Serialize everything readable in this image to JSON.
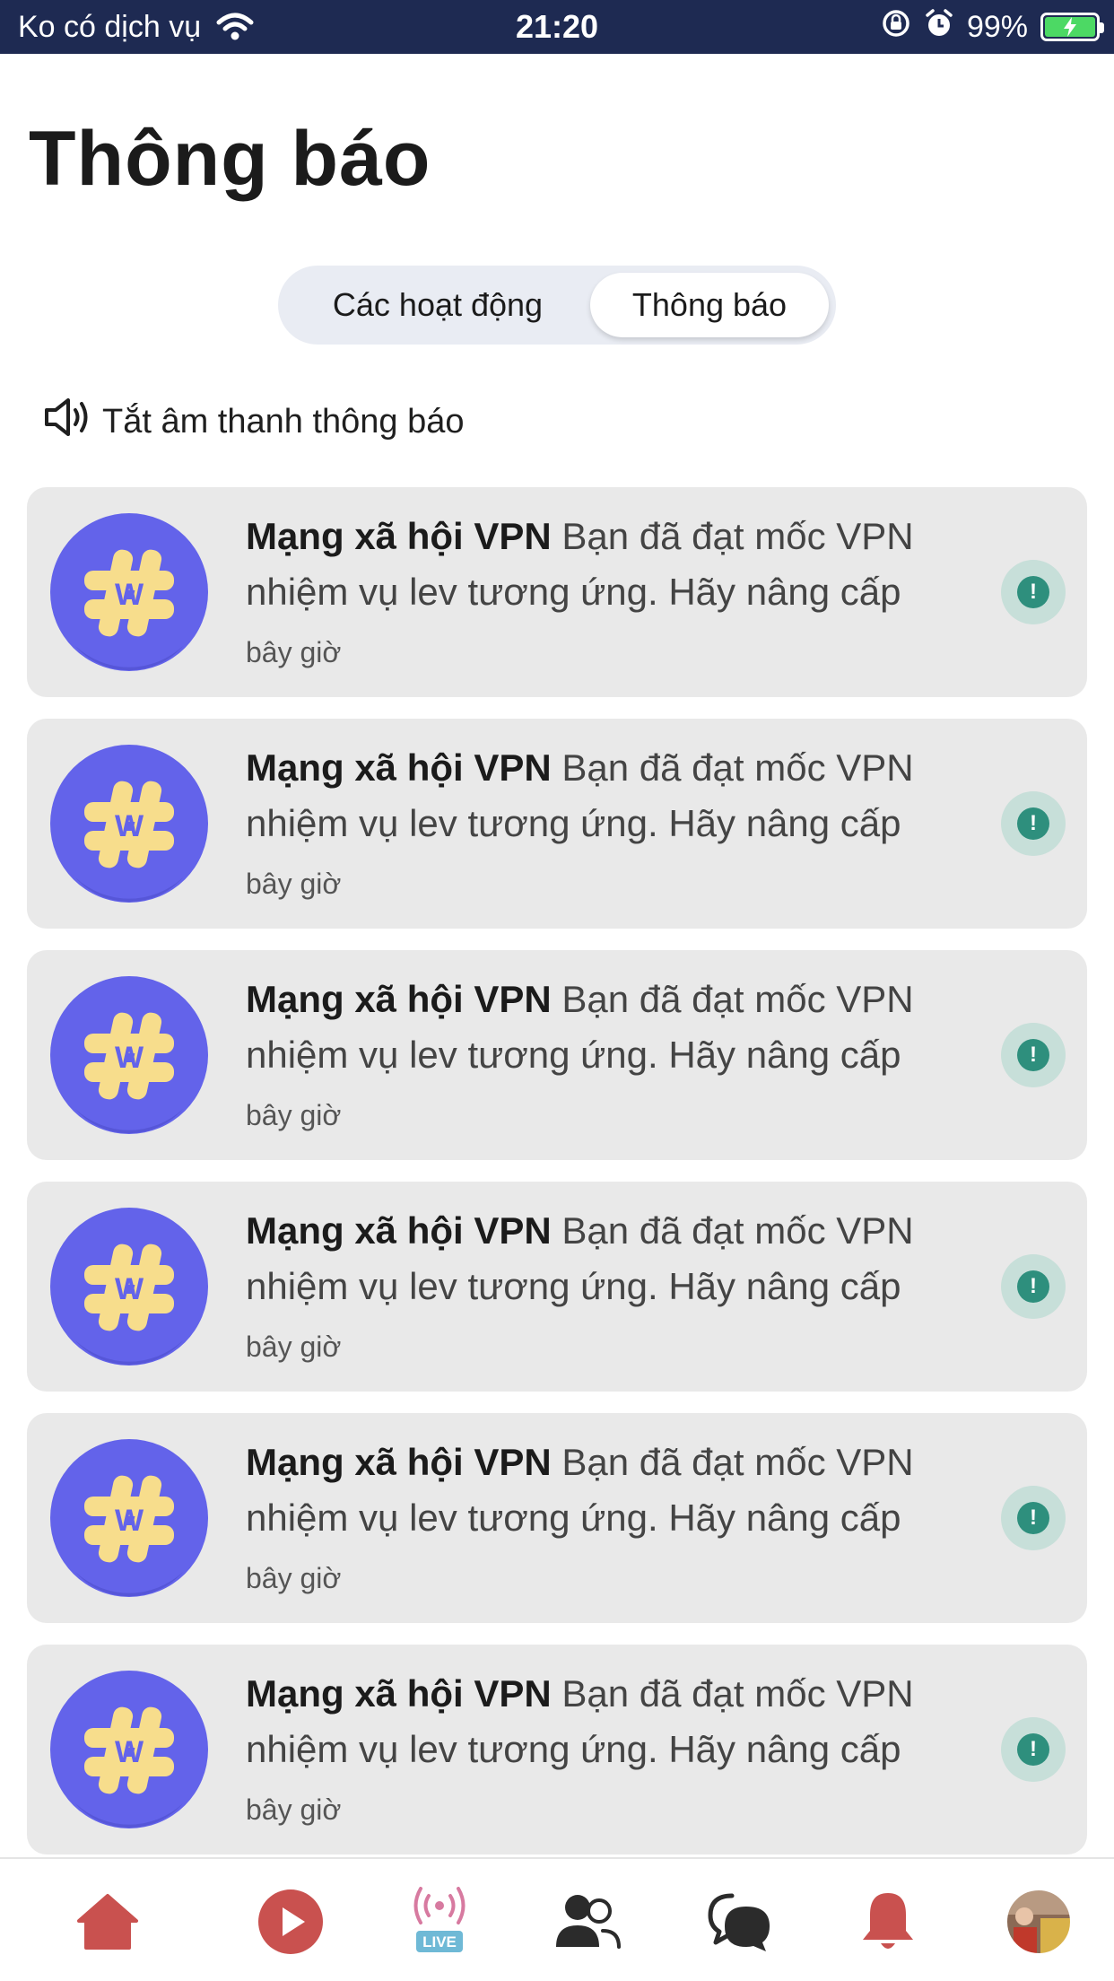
{
  "status_bar": {
    "carrier": "Ko có dịch vụ",
    "time": "21:20",
    "battery": "99%"
  },
  "header": {
    "title": "Thông báo"
  },
  "tabs": [
    {
      "label": "Các hoạt động",
      "active": false
    },
    {
      "label": "Thông báo",
      "active": true
    }
  ],
  "mute": {
    "label": "Tắt âm thanh thông báo"
  },
  "notifications": [
    {
      "sender": "Mạng xã hội VPN",
      "line1_rest": "Bạn đã đạt mốc VPN",
      "line2": "nhiệm vụ lev tương ứng. Hãy nâng cấp",
      "time": "bây giờ"
    },
    {
      "sender": "Mạng xã hội VPN",
      "line1_rest": "Bạn đã đạt mốc VPN",
      "line2": "nhiệm vụ lev tương ứng. Hãy nâng cấp",
      "time": "bây giờ"
    },
    {
      "sender": "Mạng xã hội VPN",
      "line1_rest": "Bạn đã đạt mốc VPN",
      "line2": "nhiệm vụ lev tương ứng. Hãy nâng cấp",
      "time": "bây giờ"
    },
    {
      "sender": "Mạng xã hội VPN",
      "line1_rest": "Bạn đã đạt mốc VPN",
      "line2": "nhiệm vụ lev tương ứng. Hãy nâng cấp",
      "time": "bây giờ"
    },
    {
      "sender": "Mạng xã hội VPN",
      "line1_rest": "Bạn đã đạt mốc VPN",
      "line2": "nhiệm vụ lev tương ứng. Hãy nâng cấp",
      "time": "bây giờ"
    },
    {
      "sender": "Mạng xã hội VPN",
      "line1_rest": "Bạn đã đạt mốc VPN",
      "line2": "nhiệm vụ lev tương ứng. Hãy nâng cấp",
      "time": "bây giờ"
    }
  ],
  "bottom_nav": {
    "live_label": "LIVE",
    "items": [
      "home-icon",
      "play-icon",
      "live-icon",
      "friends-icon",
      "chat-icon",
      "bell-icon",
      "profile-avatar"
    ]
  },
  "colors": {
    "status_bar": "#1e2a52",
    "avatar_bg": "#6363ea",
    "avatar_glyph": "#f7dd8c",
    "nav_red": "#c9514f",
    "alert_bg": "#c7dfd9",
    "alert_fg": "#2e8f7d"
  }
}
